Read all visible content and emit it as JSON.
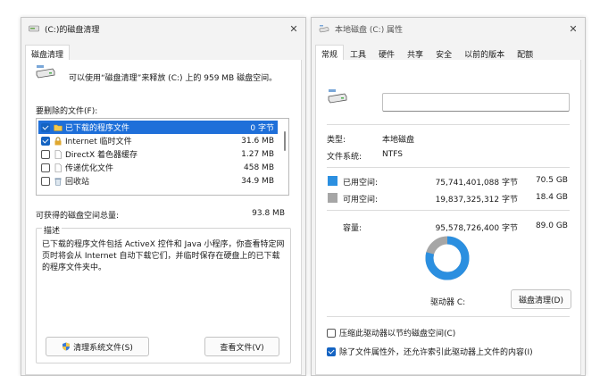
{
  "left_window": {
    "title": "(C:)的磁盘清理",
    "tab": "磁盘清理",
    "intro": "可以使用“磁盘清理”来释放 (C:) 上的 959 MB 磁盘空间。",
    "list_label": "要删除的文件(F):",
    "files": [
      {
        "name": "已下载的程序文件",
        "size": "0 字节",
        "checked": true,
        "selected": true,
        "icon": "folder-icon"
      },
      {
        "name": "Internet 临时文件",
        "size": "31.6 MB",
        "checked": true,
        "selected": false,
        "icon": "lock-icon"
      },
      {
        "name": "DirectX 着色器缓存",
        "size": "1.27 MB",
        "checked": false,
        "selected": false,
        "icon": "file-icon"
      },
      {
        "name": "传递优化文件",
        "size": "458 MB",
        "checked": false,
        "selected": false,
        "icon": "file-icon"
      },
      {
        "name": "回收站",
        "size": "34.9 MB",
        "checked": false,
        "selected": false,
        "icon": "recycle-bin-icon"
      }
    ],
    "total_label": "可获得的磁盘空间总量:",
    "total_value": "93.8 MB",
    "desc_title": "描述",
    "desc_text": "已下载的程序文件包括 ActiveX 控件和 Java 小程序，你查看特定网页时将会从 Internet 自动下载它们，并临时保存在硬盘上的已下载的程序文件夹中。",
    "cleanup_system_button": "清理系统文件(S)",
    "view_files_button": "查看文件(V)"
  },
  "right_window": {
    "title": "本地磁盘 (C:) 属性",
    "tabs": [
      "常规",
      "工具",
      "硬件",
      "共享",
      "安全",
      "以前的版本",
      "配额"
    ],
    "active_tab": 0,
    "name_value": "",
    "type_label": "类型:",
    "type_value": "本地磁盘",
    "fs_label": "文件系统:",
    "fs_value": "NTFS",
    "used_label": "已用空间:",
    "used_bytes": "75,741,401,088 字节",
    "used_gb": "70.5 GB",
    "free_label": "可用空间:",
    "free_bytes": "19,837,325,312 字节",
    "free_gb": "18.4 GB",
    "capacity_label": "容量:",
    "capacity_bytes": "95,578,726,400 字节",
    "capacity_gb": "89.0 GB",
    "used_fraction": 0.793,
    "drive_label": "驱动器 C:",
    "cleanup_button": "磁盘清理(D)",
    "compress_label": "压缩此驱动器以节约磁盘空间(C)",
    "compress_checked": false,
    "index_label": "除了文件属性外，还允许索引此驱动器上文件的内容(I)",
    "index_checked": true
  },
  "colors": {
    "used": "#2b8fe0",
    "free": "#a6a6a6",
    "selection": "#1e6fd9"
  }
}
